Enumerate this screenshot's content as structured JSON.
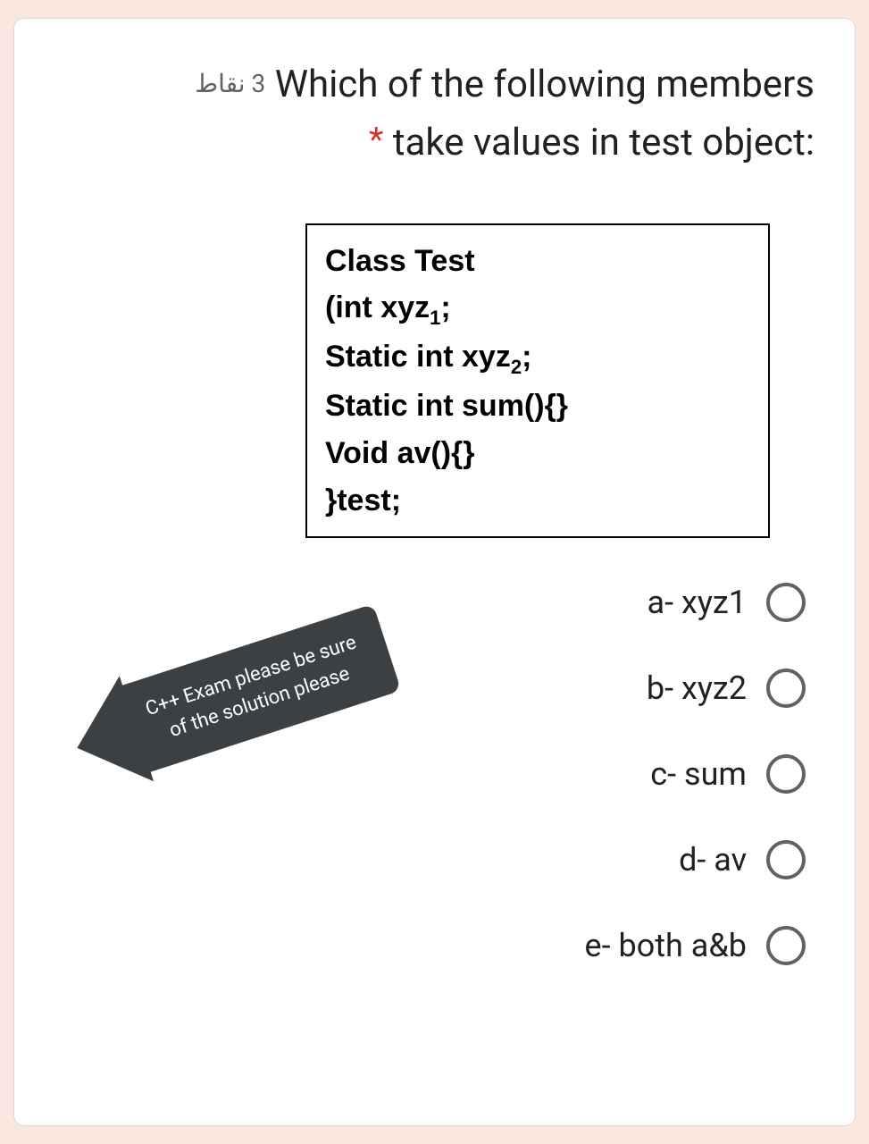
{
  "question": {
    "points_label": "3 نقاط",
    "title_line1": "Which of the following members",
    "title_line2": ":take values in test object",
    "required": "*"
  },
  "code": {
    "l1a": "Class Test",
    "l2a": "(int xyz",
    "l2b": "1",
    "l2c": ";",
    "l3a": "Static int xyz",
    "l3b": "2",
    "l3c": ";",
    "l4a": "Static int sum(){}",
    "l5a": "Void av(){}",
    "l6a": "}test;"
  },
  "options": [
    {
      "label": "a- xyz1"
    },
    {
      "label": "b- xyz2"
    },
    {
      "label": "c- sum"
    },
    {
      "label": "d- av"
    },
    {
      "label": "e- both a&b"
    }
  ],
  "annotation": {
    "line1": "C++ Exam please be sure",
    "line2": "of the solution please"
  }
}
